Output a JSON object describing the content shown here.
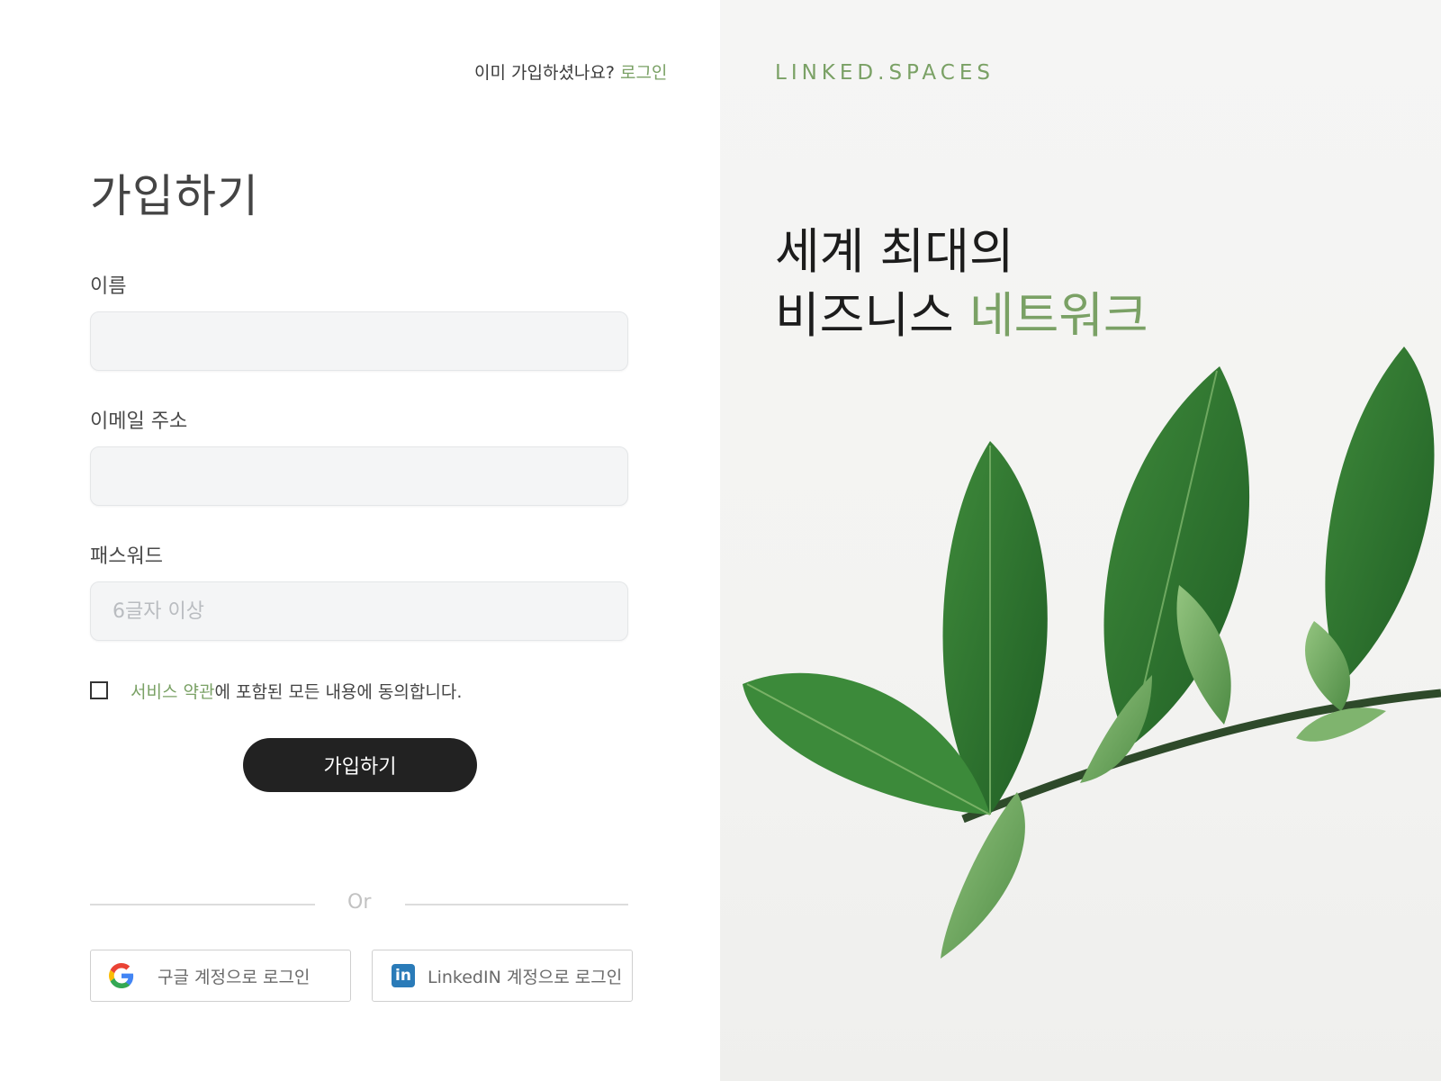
{
  "header": {
    "already_member_text": "이미 가입하셨나요?",
    "login_link": "로그인"
  },
  "form": {
    "title": "가입하기",
    "name_label": "이름",
    "name_value": "",
    "email_label": "이메일 주소",
    "email_value": "",
    "password_label": "패스워드",
    "password_placeholder": "6글자 이상",
    "password_value": "",
    "agree_checked": false,
    "agree_terms_link": "서비스 약관",
    "agree_text": "에 포함된 모든 내용에 동의합니다.",
    "submit_label": "가입하기"
  },
  "divider": {
    "label": "Or"
  },
  "social": {
    "google_label": "구글 계정으로 로그인",
    "google_icon": "google-icon",
    "linkedin_label": "LinkedIN 계정으로 로그인",
    "linkedin_icon": "linkedin-icon"
  },
  "hero": {
    "brand": "LINKED.SPACES",
    "headline_line1": "세계 최대의",
    "headline_line2_plain": "비즈니스 ",
    "headline_line2_accent": "네트워크"
  },
  "colors": {
    "accent_green": "#7aa165",
    "button_dark": "#222222",
    "linkedin_blue": "#2a7bb8"
  }
}
